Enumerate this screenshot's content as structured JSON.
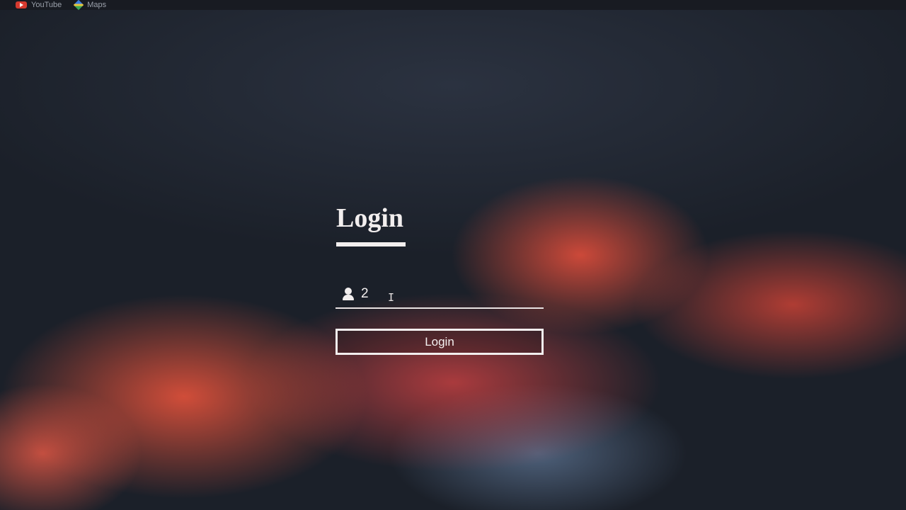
{
  "bookmarks": {
    "youtube_label": "YouTube",
    "maps_label": "Maps"
  },
  "login": {
    "title": "Login",
    "username_value": "2",
    "button_label": "Login"
  },
  "colors": {
    "text": "#f2eeee",
    "flame_accent": "#e8503c",
    "background": "#20252f"
  },
  "icons": {
    "youtube": "youtube-icon",
    "maps": "maps-icon",
    "user": "user-icon",
    "cursor": "text-cursor-icon"
  }
}
